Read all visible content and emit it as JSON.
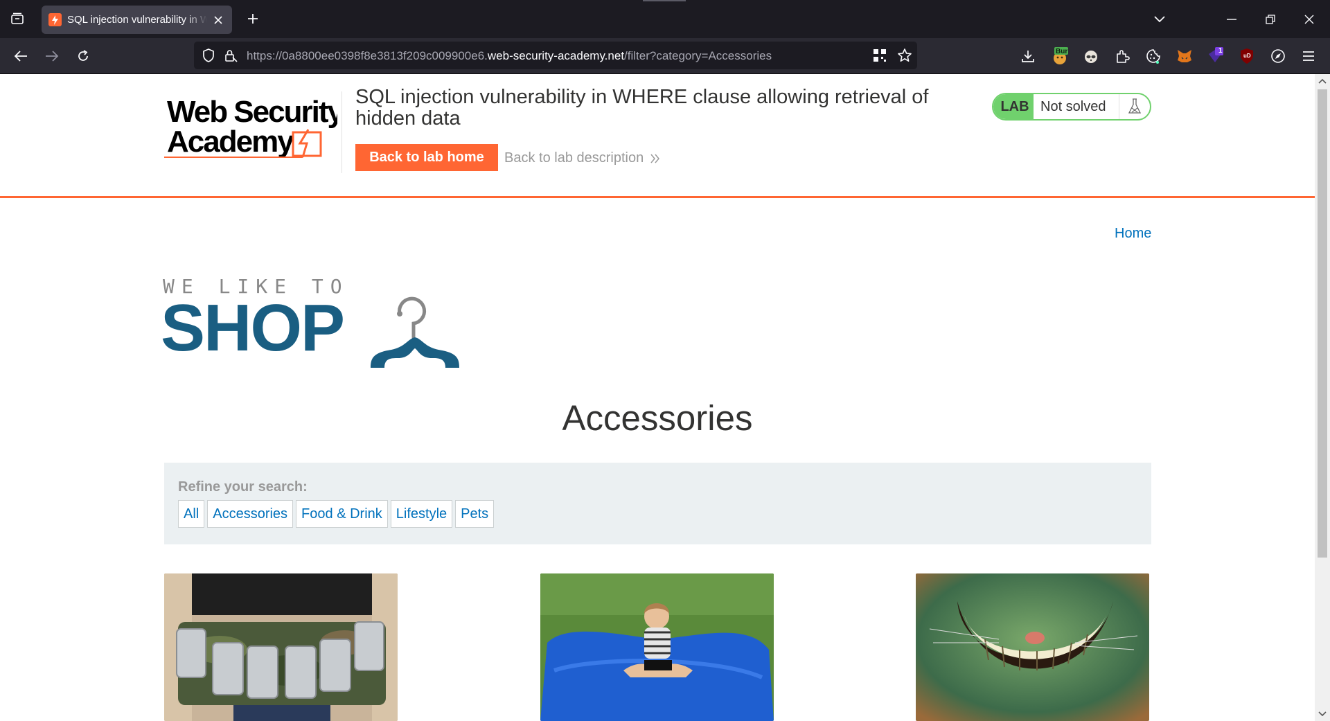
{
  "browser": {
    "tab_title": "SQL injection vulnerability in WHERE clause allowing retrieval of hidden data",
    "url_prefix": "https://0a8800ee0398f8e3813f209c009900e6.",
    "url_host": "web-security-academy.net",
    "url_path": "/filter?category=Accessories",
    "extensions": [
      "download-icon",
      "burp-extension-icon",
      "privacy-badger-icon",
      "extensions-puzzle-icon",
      "cookie-icon",
      "metamask-fox-icon",
      "notification-extension-icon",
      "ublock-origin-icon",
      "compass-icon",
      "menu-icon"
    ],
    "extension_badges": {
      "burp": "Bur",
      "notification": "1",
      "ublock": "uD"
    }
  },
  "header": {
    "logo_line1": "Web Security",
    "logo_line2": "Academy",
    "lab_title": "SQL injection vulnerability in WHERE clause allowing retrieval of hidden data",
    "back_home_label": "Back to lab home",
    "back_desc_label": "Back to lab description",
    "lab_badge": "LAB",
    "lab_status": "Not solved",
    "colors": {
      "accent": "#ff6633",
      "solved_green": "#70d16d",
      "link_blue": "#0071bc"
    }
  },
  "nav": {
    "home_label": "Home"
  },
  "shop_logo": {
    "tagline": "WE LIKE TO",
    "word": "SHOP"
  },
  "category": {
    "heading": "Accessories"
  },
  "filters": {
    "label": "Refine your search:",
    "items": [
      "All",
      "Accessories",
      "Food & Drink",
      "Lifestyle",
      "Pets"
    ]
  },
  "products": [
    {
      "image": "camouflage-beer-belt"
    },
    {
      "image": "girl-on-blue-beanbag"
    },
    {
      "image": "cheshire-cat-grin"
    }
  ]
}
